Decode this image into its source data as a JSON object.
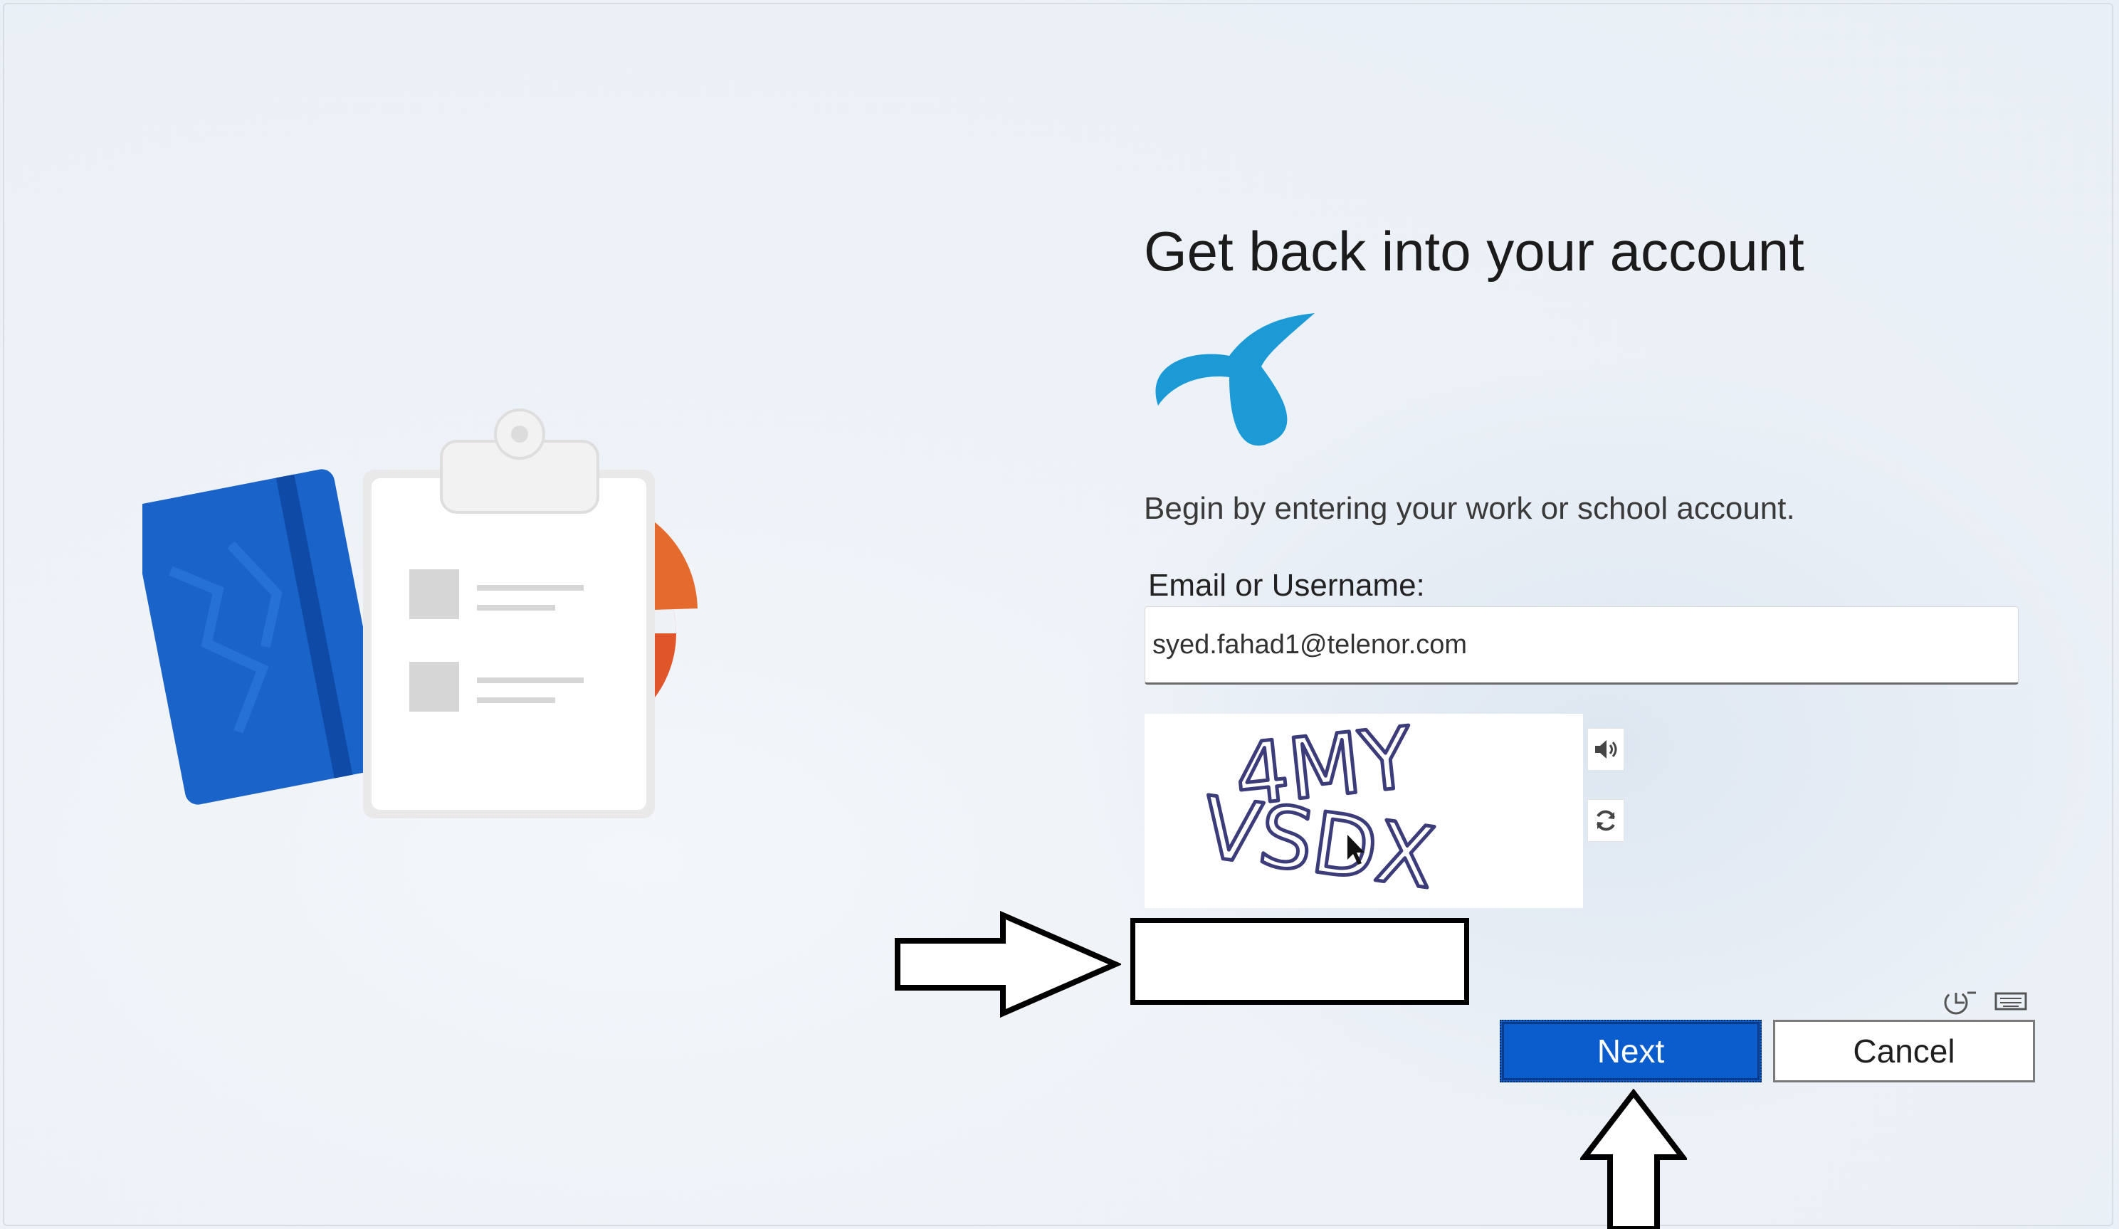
{
  "heading": "Get back into your account",
  "intro": "Begin by entering your work or school account.",
  "email": {
    "label": "Email or Username:",
    "value": "syed.fahad1@telenor.com"
  },
  "captcha": {
    "text_line1": "4MY",
    "text_line2": "VSDX",
    "audio_icon": "speaker-icon",
    "refresh_icon": "refresh-icon",
    "input_value": ""
  },
  "tools": {
    "accessibility_icon": "accessibility-icon",
    "keyboard_icon": "keyboard-icon"
  },
  "buttons": {
    "next": "Next",
    "cancel": "Cancel"
  },
  "colors": {
    "brand": "#1b9ad6",
    "primary_button": "#0b5ccd",
    "notebook": "#1a63c9",
    "chart": "#e0562a"
  }
}
